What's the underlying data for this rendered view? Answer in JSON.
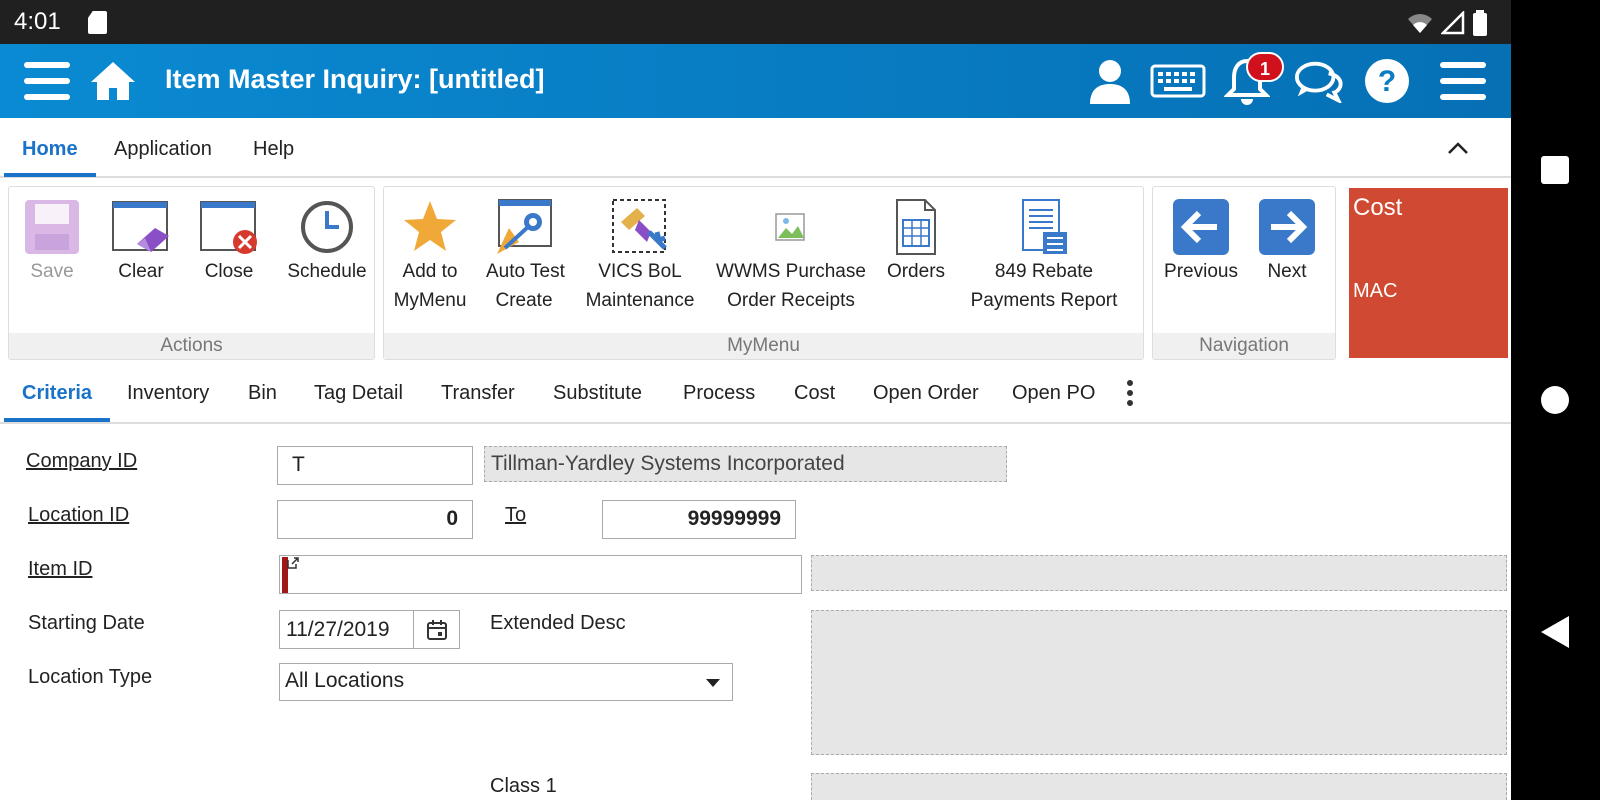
{
  "status_bar": {
    "time": "4:01"
  },
  "header": {
    "title": "Item Master Inquiry: [untitled]",
    "notification_count": "1"
  },
  "menu_tabs": [
    "Home",
    "Application",
    "Help"
  ],
  "ribbon": {
    "actions": {
      "label": "Actions",
      "buttons": [
        "Save",
        "Clear",
        "Close",
        "Schedule"
      ]
    },
    "mymenu": {
      "label": "MyMenu",
      "buttons": [
        {
          "line1": "Add to",
          "line2": "MyMenu"
        },
        {
          "line1": "Auto Test",
          "line2": "Create"
        },
        {
          "line1": "VICS BoL",
          "line2": "Maintenance"
        },
        {
          "line1": "WWMS Purchase",
          "line2": "Order Receipts"
        },
        {
          "line1": "Orders",
          "line2": ""
        },
        {
          "line1": "849 Rebate",
          "line2": "Payments Report"
        }
      ]
    },
    "navigation": {
      "label": "Navigation",
      "buttons": [
        "Previous",
        "Next"
      ]
    },
    "cost_tile": {
      "title": "Cost",
      "value": "MAC",
      "color": "#d04a33"
    }
  },
  "sub_tabs": [
    "Criteria",
    "Inventory",
    "Bin",
    "Tag Detail",
    "Transfer",
    "Substitute",
    "Process",
    "Cost",
    "Open Order",
    "Open PO"
  ],
  "form": {
    "company_id": {
      "label": "Company ID",
      "value": "T",
      "description": "Tillman-Yardley Systems Incorporated"
    },
    "location_id": {
      "label": "Location ID",
      "from": "0",
      "to_label": "To",
      "to": "99999999"
    },
    "item_id": {
      "label": "Item ID",
      "value": ""
    },
    "starting_date": {
      "label": "Starting Date",
      "value": "11/27/2019"
    },
    "extended_desc": {
      "label": "Extended Desc"
    },
    "location_type": {
      "label": "Location Type",
      "selected": "All Locations"
    },
    "class1": {
      "label": "Class 1"
    }
  },
  "colors": {
    "header_blue": "#0a7cc4",
    "accent": "#1a73c8",
    "cost_tile": "#d04a33"
  }
}
